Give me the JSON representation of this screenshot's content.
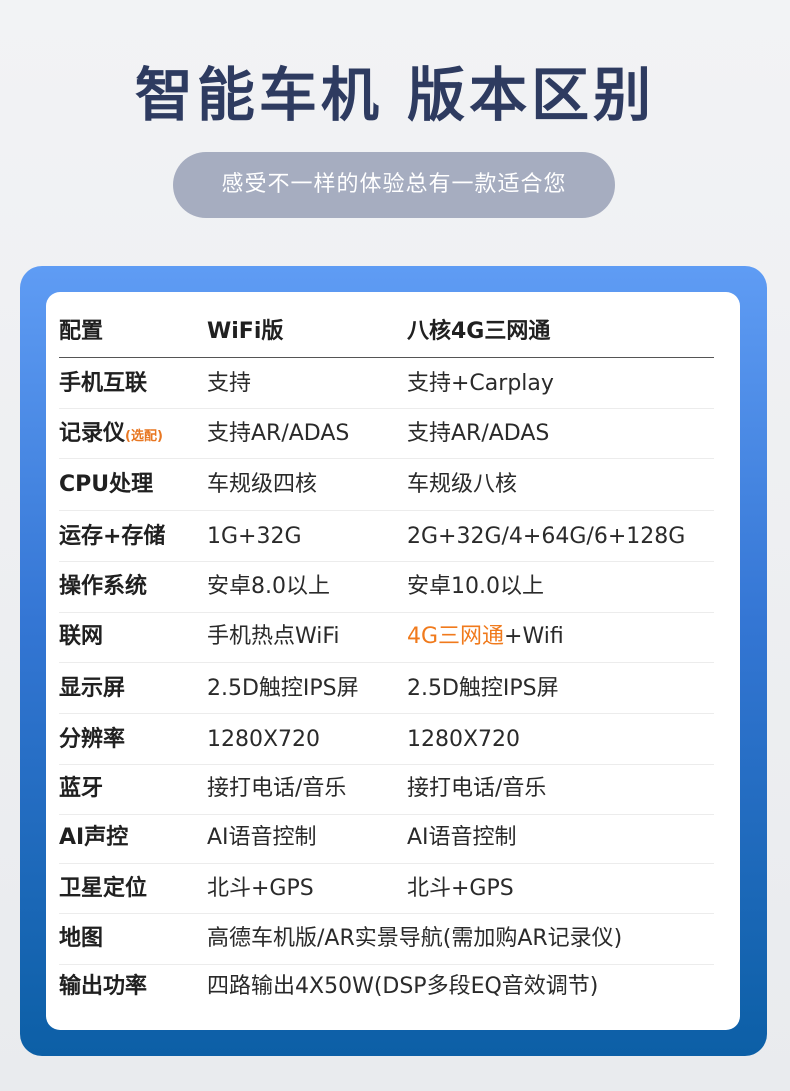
{
  "header": {
    "title": "智能车机 版本区别",
    "subtitle": "感受不一样的体验总有一款适合您"
  },
  "table": {
    "columns": [
      "配置",
      "WiFi版",
      "八核4G三网通"
    ],
    "rows": [
      {
        "label": "手机互联",
        "wifi": "支持",
        "pro": "支持+Carplay"
      },
      {
        "label": "记录仪",
        "note": "(选配)",
        "wifi": "支持AR/ADAS",
        "pro": "支持AR/ADAS"
      },
      {
        "label": "CPU处理",
        "wifi": "车规级四核",
        "pro": "车规级八核"
      },
      {
        "label": "运存+存储",
        "wifi": "1G+32G",
        "pro": "2G+32G/4+64G/6+128G"
      },
      {
        "label": "操作系统",
        "wifi": "安卓8.0以上",
        "pro": "安卓10.0以上"
      },
      {
        "label": "联网",
        "wifi": "手机热点WiFi",
        "pro_highlight": "4G三网通",
        "pro_rest": "+Wifi"
      },
      {
        "label": "显示屏",
        "wifi": "2.5D触控IPS屏",
        "pro": "2.5D触控IPS屏"
      },
      {
        "label": "分辨率",
        "wifi": "1280X720",
        "pro": "1280X720"
      },
      {
        "label": "蓝牙",
        "wifi": "接打电话/音乐",
        "pro": "接打电话/音乐"
      },
      {
        "label": "AI声控",
        "wifi": "AI语音控制",
        "pro": "AI语音控制"
      },
      {
        "label": "卫星定位",
        "wifi": "北斗+GPS",
        "pro": "北斗+GPS"
      },
      {
        "label": "地图",
        "shared": "高德车机版/AR实景导航(需加购AR记录仪)"
      },
      {
        "label": "输出功率",
        "shared": "四路输出4X50W(DSP多段EQ音效调节)"
      }
    ]
  },
  "colors": {
    "title": "#2e3b60",
    "subtitle_bg": "#a6adc0",
    "panel_top": "#5f9cf4",
    "panel_bottom": "#0c5fa6",
    "highlight": "#f07a1c"
  }
}
